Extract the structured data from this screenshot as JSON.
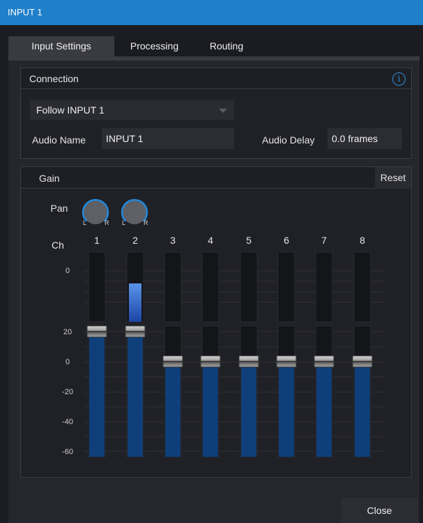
{
  "window": {
    "title": "INPUT 1"
  },
  "tabs": [
    {
      "label": "Input Settings",
      "active": true
    },
    {
      "label": "Processing",
      "active": false
    },
    {
      "label": "Routing",
      "active": false
    }
  ],
  "connection": {
    "header": "Connection",
    "info_icon": "info-icon",
    "source_select": {
      "value": "Follow INPUT 1"
    },
    "audio_name": {
      "label": "Audio Name",
      "value": "INPUT 1"
    },
    "audio_delay": {
      "label": "Audio Delay",
      "value": "0.0 frames"
    }
  },
  "gain": {
    "header": "Gain",
    "reset_label": "Reset",
    "pan_label": "Pan",
    "pan_knobs": [
      {
        "left": "L",
        "right": "R"
      },
      {
        "left": "L",
        "right": "R"
      }
    ],
    "ch_label": "Ch",
    "meter_scale": [
      "0"
    ],
    "fader_scale": [
      "20",
      "0",
      "-20",
      "-40",
      "-60"
    ],
    "channels": [
      {
        "number": "1",
        "fader_db": 20,
        "meter_level": 0
      },
      {
        "number": "2",
        "fader_db": 20,
        "meter_level": 0.55
      },
      {
        "number": "3",
        "fader_db": 0,
        "meter_level": 0
      },
      {
        "number": "4",
        "fader_db": 0,
        "meter_level": 0
      },
      {
        "number": "5",
        "fader_db": 0,
        "meter_level": 0
      },
      {
        "number": "6",
        "fader_db": 0,
        "meter_level": 0
      },
      {
        "number": "7",
        "fader_db": 0,
        "meter_level": 0
      },
      {
        "number": "8",
        "fader_db": 0,
        "meter_level": 0
      }
    ]
  },
  "footer": {
    "close_label": "Close"
  },
  "colors": {
    "accent": "#1f7fc9",
    "fader_fill": "#0f3f7a",
    "meter_active": "#3b78d8"
  }
}
